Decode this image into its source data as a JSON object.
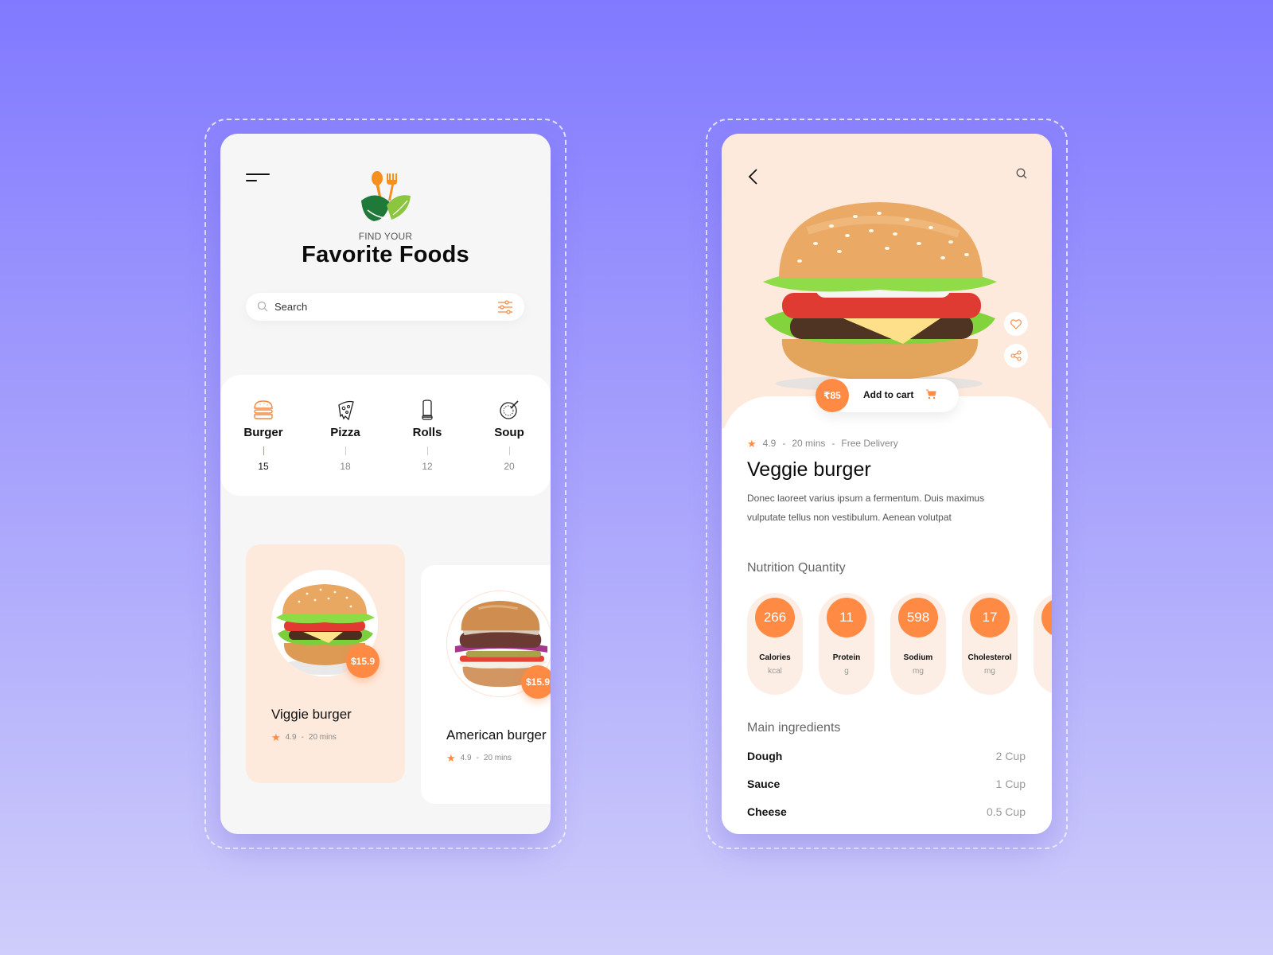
{
  "home": {
    "logo": "fork-spoon-leaf-logo",
    "kicker": "FIND YOUR",
    "title": "Favorite Foods",
    "search": {
      "placeholder": "Search",
      "value": ""
    },
    "categories": [
      {
        "label": "Burger",
        "count": "15",
        "icon": "burger-icon",
        "active": true
      },
      {
        "label": "Pizza",
        "count": "18",
        "icon": "pizza-icon",
        "active": false
      },
      {
        "label": "Rolls",
        "count": "12",
        "icon": "roll-icon",
        "active": false
      },
      {
        "label": "Soup",
        "count": "20",
        "icon": "soup-icon",
        "active": false
      }
    ],
    "cards": [
      {
        "name": "Viggie burger",
        "price": "$15.9",
        "rating": "4.9",
        "sep": "-",
        "time": "20 mins"
      },
      {
        "name": "American burger",
        "price": "$15.9",
        "rating": "4.9",
        "sep": "-",
        "time": "20 mins"
      }
    ]
  },
  "detail": {
    "price": "₹85",
    "add_to_cart": "Add to cart",
    "rating": "4.9",
    "sep": "-",
    "time": "20 mins",
    "delivery": "Free Delivery",
    "title": "Veggie burger",
    "description": "Donec laoreet varius ipsum a fermentum. Duis maximus vulputate tellus non vestibulum. Aenean volutpat",
    "nutrition_title": "Nutrition Quantity",
    "nutrition": [
      {
        "value": "266",
        "label": "Calories",
        "unit": "kcal"
      },
      {
        "value": "11",
        "label": "Protein",
        "unit": "g"
      },
      {
        "value": "598",
        "label": "Sodium",
        "unit": "mg"
      },
      {
        "value": "17",
        "label": "Cholesterol",
        "unit": "mg"
      },
      {
        "value": "",
        "label": "C",
        "unit": ""
      }
    ],
    "ingredients_title": "Main ingredients",
    "ingredients": [
      {
        "name": "Dough",
        "qty": "2 Cup"
      },
      {
        "name": "Sauce",
        "qty": "1 Cup"
      },
      {
        "name": "Cheese",
        "qty": "0.5 Cup"
      }
    ]
  },
  "colors": {
    "accent": "#ff8a44",
    "peach": "#feeadd",
    "bg_top": "#8179ff",
    "bg_bottom": "#cfcdfb"
  }
}
